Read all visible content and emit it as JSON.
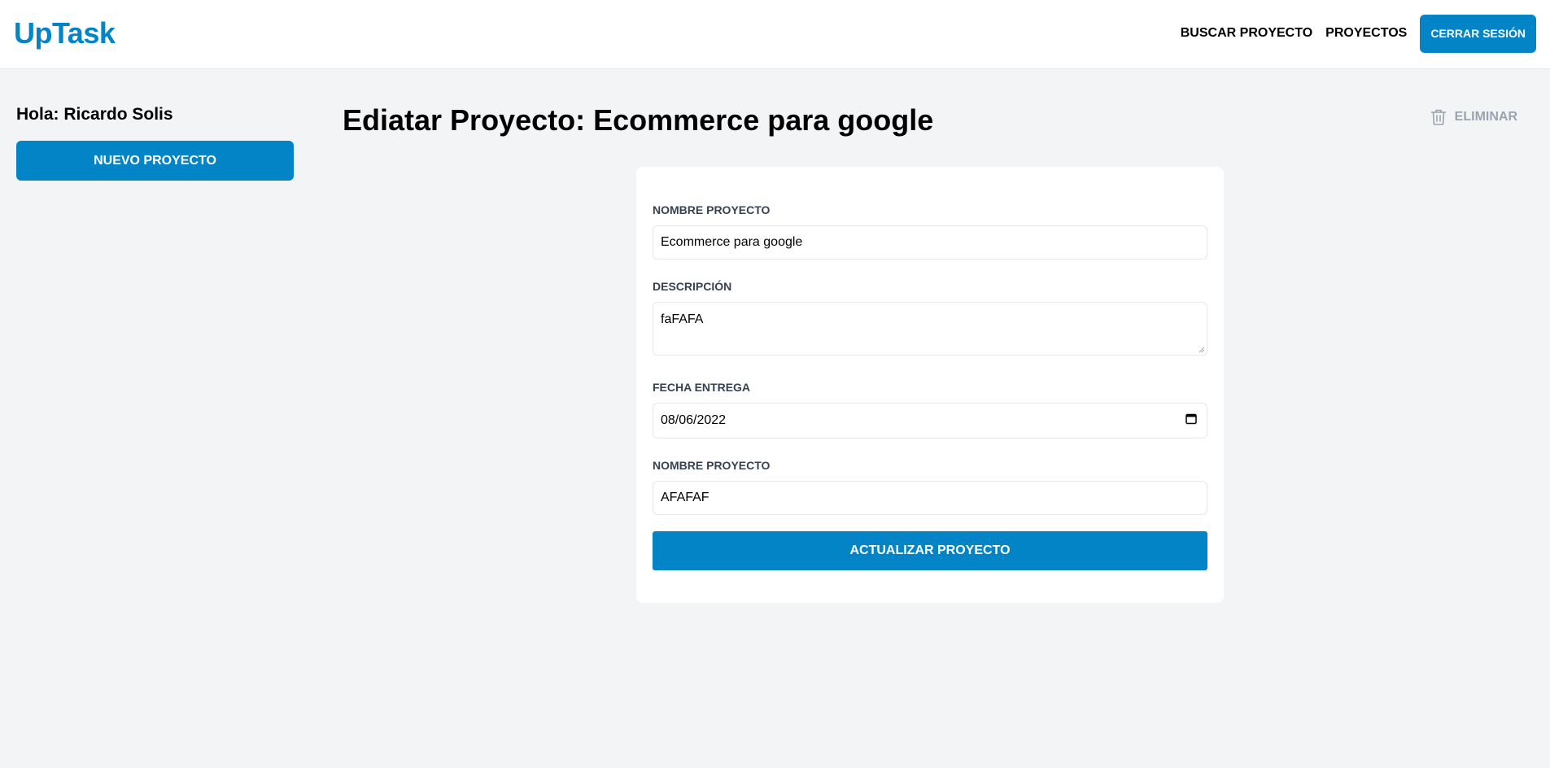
{
  "header": {
    "logo": "UpTask",
    "nav": {
      "search_label": "Buscar Proyecto",
      "projects_label": "Proyectos",
      "logout_label": "Cerrar Sesión"
    }
  },
  "sidebar": {
    "greeting": "Hola: Ricardo Solis",
    "new_project_label": "Nuevo Proyecto"
  },
  "main": {
    "title": "Ediatar Proyecto: Ecommerce para google",
    "delete_label": "Eliminar",
    "delete_icon": "trash-icon"
  },
  "form": {
    "name_label": "Nombre Proyecto",
    "name_value": "Ecommerce para google",
    "description_label": "Descripción",
    "description_value": "faFAFA",
    "date_label": "Fecha Entrega",
    "date_value": "08/06/2022",
    "date_icon": "calendar-icon",
    "client_label": "Nombre Proyecto",
    "client_value": "AFAFAF",
    "submit_label": "Actualizar Proyecto"
  },
  "colors": {
    "accent": "#0284c7",
    "background": "#f3f4f6",
    "muted": "#9ca3af"
  }
}
